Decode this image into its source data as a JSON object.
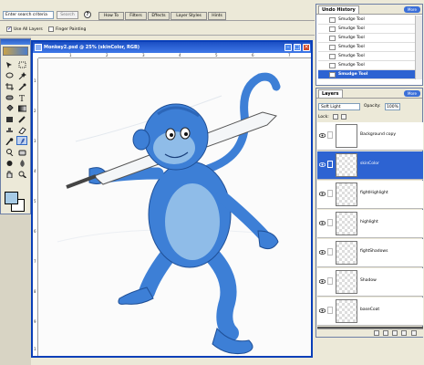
{
  "search": {
    "placeholder": "Enter search criteria",
    "button": "Search"
  },
  "palette_tabs": [
    "How To",
    "Filters",
    "Effects",
    "Layer Styles",
    "Hints"
  ],
  "options": {
    "use_all_layers": "Use All Layers",
    "finger_painting": "Finger Painting"
  },
  "document": {
    "title": "Monkey2.psd @ 25% (skinColor, RGB)",
    "ruler_top": [
      "1",
      "2",
      "3",
      "4",
      "5",
      "6",
      "7"
    ],
    "ruler_left": [
      "1",
      "2",
      "3",
      "4",
      "5",
      "6",
      "7",
      "8",
      "9",
      "1"
    ]
  },
  "undo": {
    "tab": "Undo History",
    "more": "More",
    "items": [
      "Smudge Tool",
      "Smudge Tool",
      "Smudge Tool",
      "Smudge Tool",
      "Smudge Tool",
      "Smudge Tool",
      "Smudge Tool",
      "Smudge Tool"
    ],
    "selected_index": 7
  },
  "layers": {
    "tab": "Layers",
    "more": "More",
    "blend_mode": "Soft Light",
    "opacity_label": "Opacity:",
    "opacity": "100%",
    "lock_label": "Lock:",
    "items": [
      "Background copy",
      "skinColor",
      "fightHighlight",
      "highlight",
      "fightShadows",
      "Shadow",
      "baseCoat",
      ""
    ],
    "selected_index": 1
  },
  "colors": {
    "accent": "#2d63d2",
    "foreground": "#a7cbe6",
    "monkey": "#3d7fd6"
  },
  "icons": [
    "help-icon",
    "eye-icon",
    "brush-icon",
    "lock-icon",
    "trash-icon",
    "new-layer-icon",
    "smudge-icon"
  ]
}
